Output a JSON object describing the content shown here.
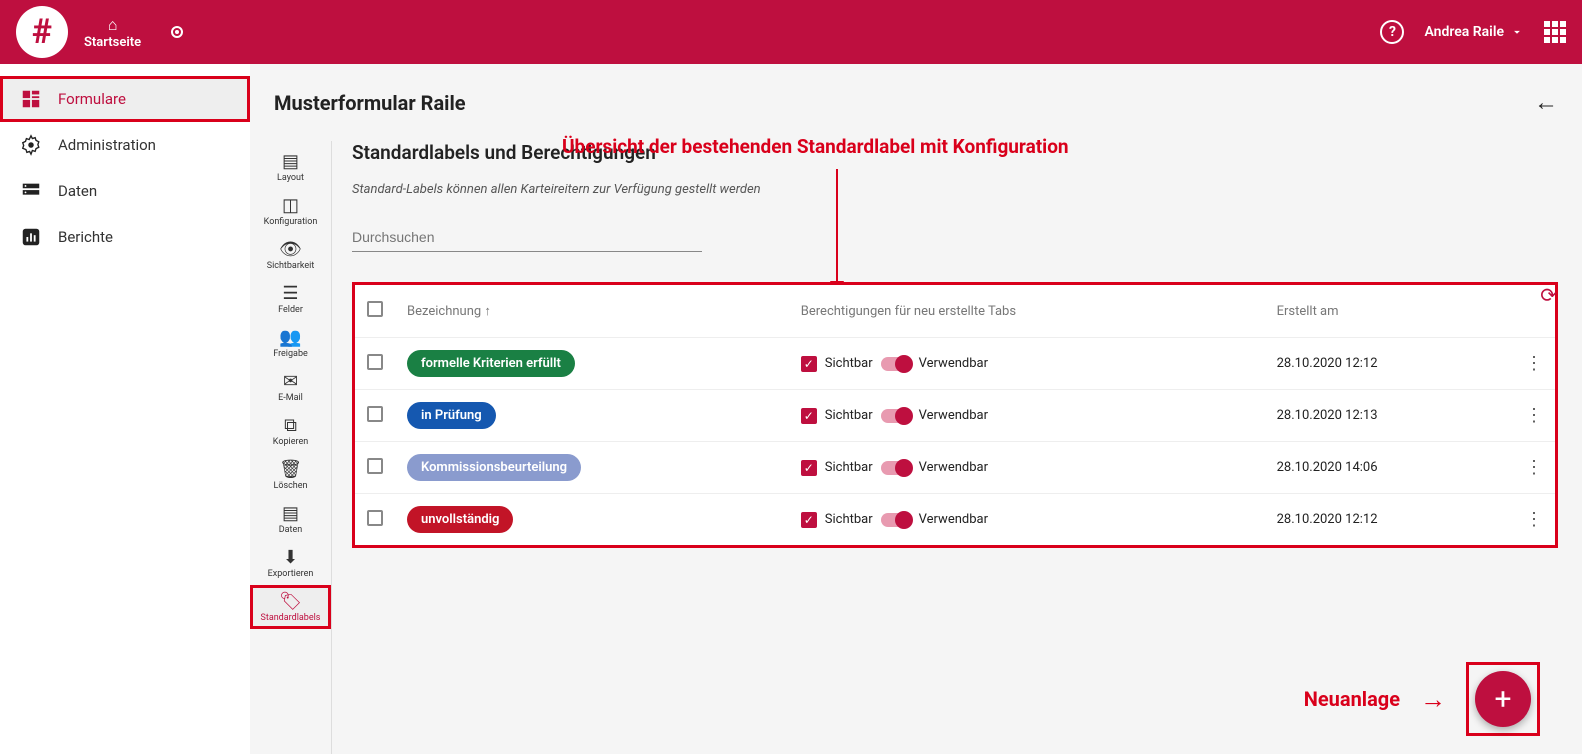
{
  "topbar": {
    "home": "Startseite",
    "user": "Andrea Raile"
  },
  "sidenav": {
    "items": [
      {
        "label": "Formulare",
        "icon": "dashboard"
      },
      {
        "label": "Administration",
        "icon": "gear"
      },
      {
        "label": "Daten",
        "icon": "storage"
      },
      {
        "label": "Berichte",
        "icon": "chart"
      }
    ]
  },
  "page": {
    "title": "Musterformular Raile"
  },
  "mininav": {
    "items": [
      {
        "label": "Layout"
      },
      {
        "label": "Konfiguration"
      },
      {
        "label": "Sichtbarkeit"
      },
      {
        "label": "Felder"
      },
      {
        "label": "Freigabe"
      },
      {
        "label": "E-Mail"
      },
      {
        "label": "Kopieren"
      },
      {
        "label": "Löschen"
      },
      {
        "label": "Daten"
      },
      {
        "label": "Exportieren"
      },
      {
        "label": "Standardlabels"
      }
    ]
  },
  "panel": {
    "heading": "Standardlabels und Berechtigungen",
    "subtitle": "Standard-Labels können allen Karteireitern zur Verfügung gestellt werden",
    "annotation": "Übersicht der bestehenden Standardlabel mit Konfiguration",
    "search_placeholder": "Durchsuchen"
  },
  "table": {
    "cols": {
      "name": "Bezeichnung",
      "perms": "Berechtigungen für neu erstellte Tabs",
      "created": "Erstellt am"
    },
    "perm_labels": {
      "visible": "Sichtbar",
      "usable": "Verwendbar"
    },
    "rows": [
      {
        "name": "formelle Kriterien erfüllt",
        "color": "#1a8044",
        "created": "28.10.2020 12:12"
      },
      {
        "name": "in Prüfung",
        "color": "#1558b0",
        "created": "28.10.2020 12:13"
      },
      {
        "name": "Kommissionsbeurteilung",
        "color": "#8a9bce",
        "created": "28.10.2020 14:06"
      },
      {
        "name": "unvollständig",
        "color": "#c21427",
        "created": "28.10.2020 12:12"
      }
    ]
  },
  "fab": {
    "label": "Neuanlage"
  }
}
